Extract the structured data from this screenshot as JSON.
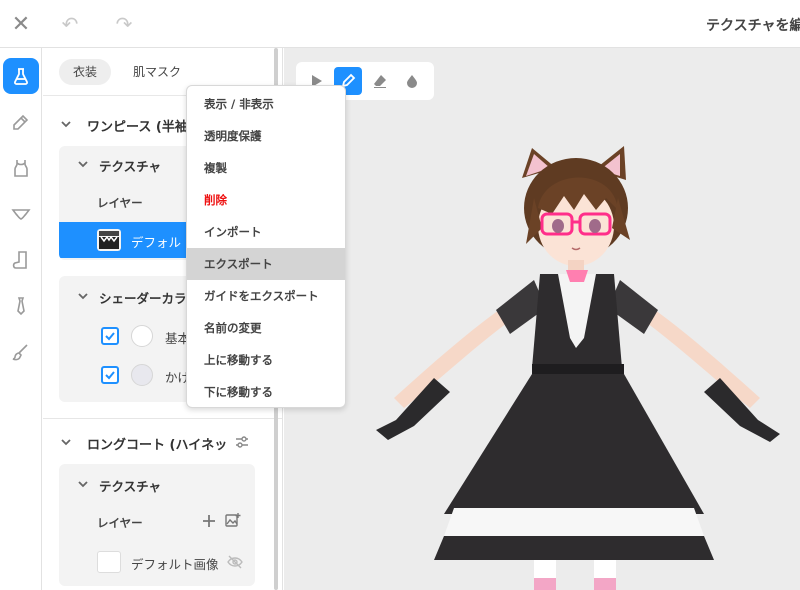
{
  "topbar": {
    "close_icon": "close-icon",
    "undo_icon": "undo-icon",
    "redo_icon": "redo-icon",
    "title": "テクスチャを編"
  },
  "rail": {
    "items": [
      {
        "name": "flask-icon",
        "active": true
      },
      {
        "name": "pencil-case-icon",
        "active": false
      },
      {
        "name": "tank-top-icon",
        "active": false
      },
      {
        "name": "underwear-icon",
        "active": false
      },
      {
        "name": "sock-icon",
        "active": false
      },
      {
        "name": "tie-icon",
        "active": false
      },
      {
        "name": "brush-icon",
        "active": false
      }
    ]
  },
  "panel": {
    "tabs": [
      "衣装",
      "肌マスク"
    ],
    "group1": {
      "title": "ワンピース (半袖",
      "texture_title": "テクスチャ",
      "layer_label": "レイヤー",
      "selected_layer": "デフォル",
      "shader_title": "シェーダーカラ",
      "shader_items": [
        {
          "label": "基本",
          "color": "#ffffff",
          "checked": true
        },
        {
          "label": "かげ",
          "color": "#e8e8ee",
          "checked": true
        }
      ]
    },
    "group2": {
      "title": "ロングコート (ハイネッ",
      "texture_title": "テクスチャ",
      "layer_label": "レイヤー",
      "layer_name": "デフォルト画像"
    }
  },
  "viewport": {
    "tools": [
      "pointer-icon",
      "pencil-icon",
      "eraser-icon",
      "fill-drop-icon"
    ],
    "active_tool": "pencil-icon"
  },
  "context_menu": {
    "items": [
      {
        "label": "表示 / 非表示",
        "highlight": false,
        "danger": false
      },
      {
        "label": "透明度保護",
        "highlight": false,
        "danger": false
      },
      {
        "label": "複製",
        "highlight": false,
        "danger": false
      },
      {
        "label": "削除",
        "highlight": false,
        "danger": true
      },
      {
        "label": "インポート",
        "highlight": false,
        "danger": false
      },
      {
        "label": "エクスポート",
        "highlight": true,
        "danger": false
      },
      {
        "label": "ガイドをエクスポート",
        "highlight": false,
        "danger": false
      },
      {
        "label": "名前の変更",
        "highlight": false,
        "danger": false
      },
      {
        "label": "上に移動する",
        "highlight": false,
        "danger": false
      },
      {
        "label": "下に移動する",
        "highlight": false,
        "danger": false
      }
    ]
  },
  "colors": {
    "accent": "#1e90ff",
    "danger": "#ee1111",
    "dress": "#2e2c2e",
    "hair": "#6b4226",
    "glasses": "#ff2e8a"
  }
}
